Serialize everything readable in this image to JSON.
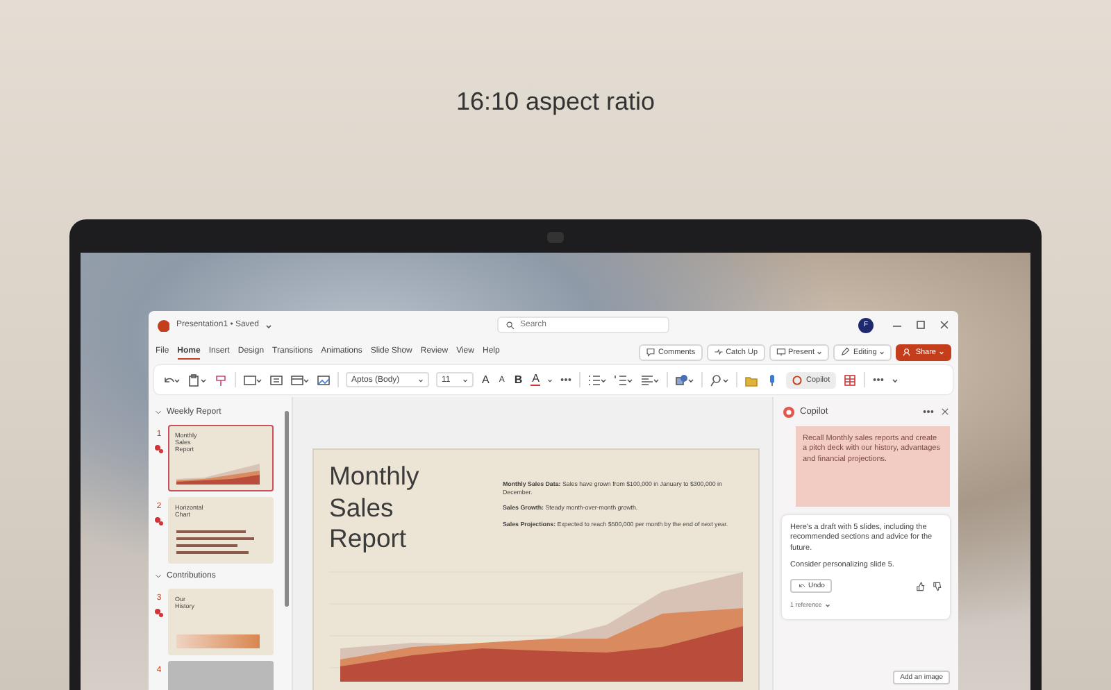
{
  "heading": "16:10 aspect ratio",
  "window": {
    "file_name": "Presentation1 • Saved",
    "search": {
      "placeholder": "Search"
    },
    "avatar": "F"
  },
  "menu": {
    "tabs": [
      {
        "label": "File",
        "selected": false
      },
      {
        "label": "Home",
        "selected": true
      },
      {
        "label": "Insert",
        "selected": false
      },
      {
        "label": "Design",
        "selected": false
      },
      {
        "label": "Transitions",
        "selected": false
      },
      {
        "label": "Animations",
        "selected": false
      },
      {
        "label": "Slide Show",
        "selected": false
      },
      {
        "label": "Review",
        "selected": false
      },
      {
        "label": "View",
        "selected": false
      },
      {
        "label": "Help",
        "selected": false
      }
    ],
    "actions": [
      {
        "label": "Comments",
        "kind": "button"
      },
      {
        "label": "Catch Up",
        "kind": "button"
      },
      {
        "label": "Present",
        "kind": "dropdown"
      },
      {
        "label": "Editing",
        "kind": "dropdown"
      },
      {
        "label": "Share",
        "kind": "primary"
      }
    ]
  },
  "ribbon": {
    "font": "Aptos (Body)",
    "size": "11",
    "glyphs": [
      {
        "glyph": "A",
        "kind": "grow"
      },
      {
        "glyph": "A",
        "kind": "shrink"
      },
      {
        "glyph": "B",
        "kind": "bold"
      },
      {
        "glyph": "A",
        "kind": "color"
      }
    ],
    "copilot": "Copilot"
  },
  "slides_pane": {
    "sections": [
      {
        "title": "Weekly Report",
        "expanded": true,
        "slides": [
          {
            "number": "1",
            "title": "Monthly Sales Report",
            "kind": "area",
            "selected": true
          },
          {
            "number": "2",
            "title": "Horizontal Chart",
            "kind": "bars",
            "selected": false
          }
        ]
      },
      {
        "title": "Contributions",
        "expanded": true,
        "slides": [
          {
            "number": "3",
            "title": "Our History",
            "kind": "timeline",
            "selected": false
          },
          {
            "number": "4",
            "kind": "blank",
            "selected": false
          }
        ]
      }
    ]
  },
  "slide": {
    "title": "Monthly Sales Report",
    "bullets": [
      "**Monthly Sales Data:** Sales have grown from $100,000 in January to $300,000 in December.",
      "**Sales Growth:** Steady month-over-month growth.",
      "**Sales Projections:** Expected to reach $500,000 per month by the end of next year."
    ]
  },
  "copilot": {
    "title": "Copilot",
    "prompt": "Recall Monthly sales reports and create a pitch deck with our history, advantages and financial projections.",
    "response": [
      "Here's a draft with 5 slides, including the recommended sections and advice for the future.",
      "Consider personalizing slide 5."
    ],
    "undo": "Undo",
    "references": "1 reference",
    "add_image": "Add an image"
  }
}
